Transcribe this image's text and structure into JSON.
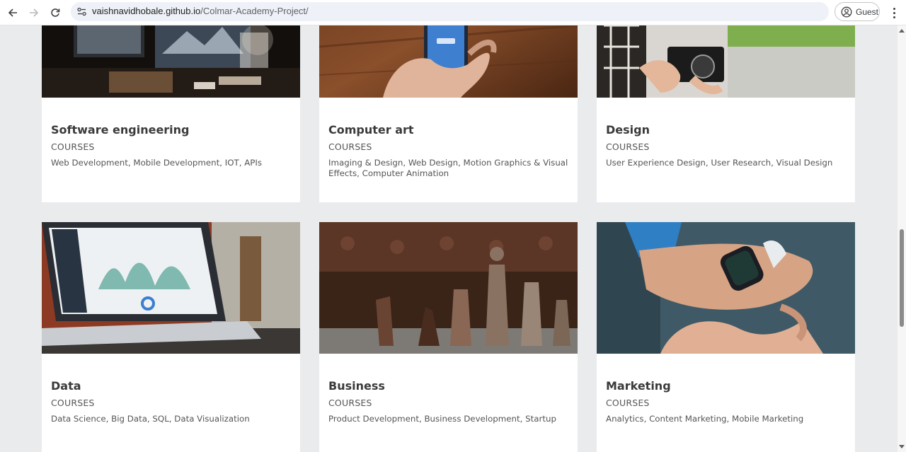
{
  "browser": {
    "url_host": "vaishnavidhobale.github.io",
    "url_path": "/Colmar-Academy-Project/",
    "profile_label": "Guest"
  },
  "courses": [
    {
      "title": "Software engineering",
      "subtitle": "COURSES",
      "description": "Web Development, Mobile Development, IOT, APIs",
      "image": "desk-computer-monitors-photo"
    },
    {
      "title": "Computer art",
      "subtitle": "COURSES",
      "description": "Imaging & Design, Web Design, Motion Graphics & Visual Effects, Computer Animation",
      "image": "hand-holding-phone-photo"
    },
    {
      "title": "Design",
      "subtitle": "COURSES",
      "description": "User Experience Design, User Research, Visual Design",
      "image": "person-holding-camera-photo"
    },
    {
      "title": "Data",
      "subtitle": "COURSES",
      "description": "Data Science, Big Data, SQL, Data Visualization",
      "image": "laptop-dashboard-photo"
    },
    {
      "title": "Business",
      "subtitle": "COURSES",
      "description": "Product Development, Business Development, Startup",
      "image": "chess-pieces-photo"
    },
    {
      "title": "Marketing",
      "subtitle": "COURSES",
      "description": "Analytics, Content Marketing, Mobile Marketing",
      "image": "smartwatch-wrist-photo"
    }
  ]
}
